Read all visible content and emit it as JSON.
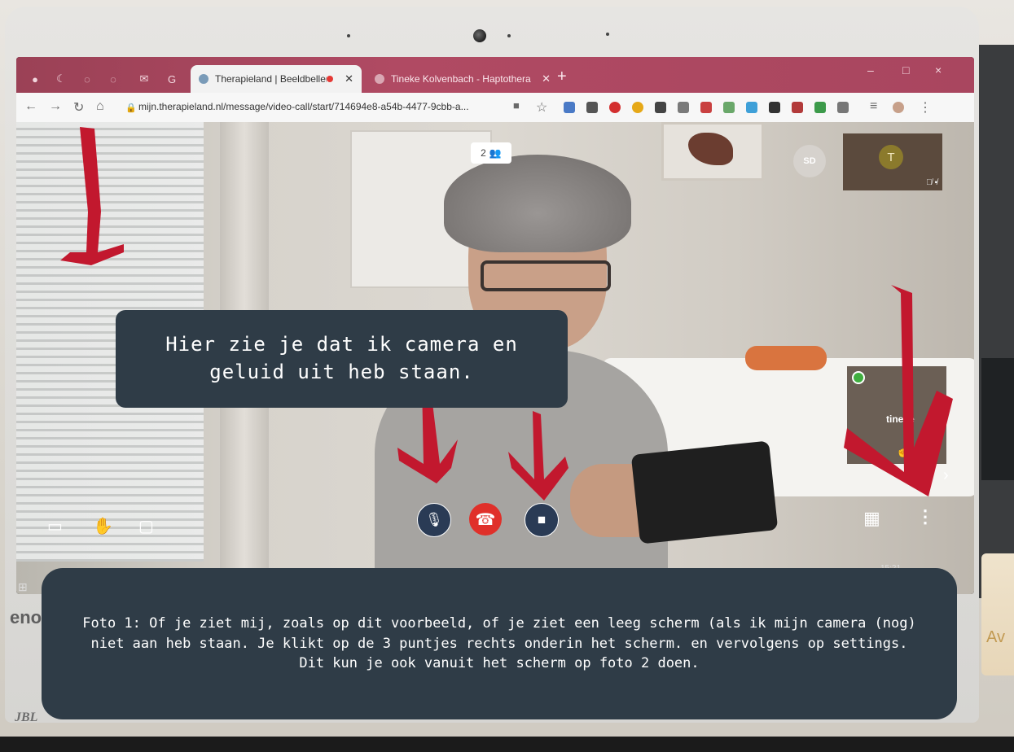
{
  "browser": {
    "tabs": [
      {
        "label": "Therapieland | Beeldbellen",
        "recording": true,
        "active": true
      },
      {
        "label": "Tineke Kolvenbach - Haptothera",
        "active": false
      }
    ],
    "new_tab": "+",
    "window_controls": {
      "minimize": "–",
      "maximize": "□",
      "close": "×"
    },
    "url": "mijn.therapieland.nl/message/video-call/start/714694e8-a54b-4477-9cbb-a..."
  },
  "call": {
    "participant_count": "2",
    "avatars": {
      "sd_initials": "SD",
      "tile_initial": "T"
    },
    "side_tile_name": "tineke",
    "colors": {
      "end_call": "#e0302a",
      "control_bg": "#2a3b55",
      "tab_bar": "#a9465f"
    }
  },
  "taskbar": {
    "clock": "15:21"
  },
  "laptop": {
    "brand_fragment": "eno",
    "speaker_brand": "JBL"
  },
  "background": {
    "paper_text": "Av"
  },
  "annotations": {
    "callout_1": "Hier zie je dat ik camera en geluid uit heb staan.",
    "callout_2": "Foto 1: Of je ziet mij,  zoals op dit voorbeeld, of je ziet een leeg scherm (als ik mijn camera (nog) niet aan heb staan. Je klikt op de 3 puntjes rechts onderin het scherm. en vervolgens op settings. Dit kun je ook vanuit het scherm op foto 2 doen."
  },
  "icons": [
    "screen-share-icon",
    "raise-hand-icon",
    "chat-icon",
    "mic-off-icon",
    "end-call-icon",
    "camera-off-icon",
    "grid-view-icon",
    "more-options-icon",
    "participants-icon",
    "lock-icon"
  ]
}
